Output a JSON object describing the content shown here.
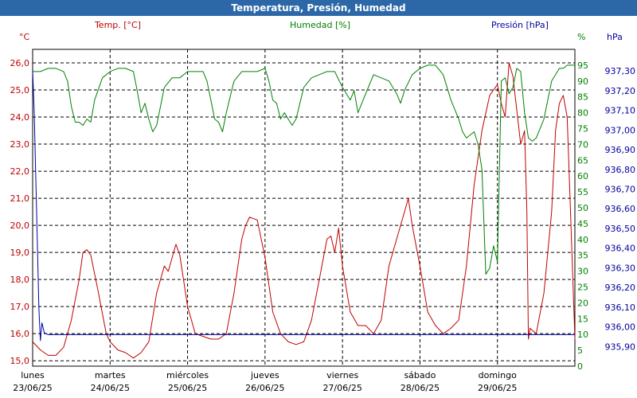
{
  "window": {
    "title": "Temperatura, Presión, Humedad"
  },
  "colors": {
    "temp": "#c00000",
    "hum": "#008000",
    "pres": "#0000a0",
    "header_bg": "#2c68a8",
    "grid": "#000000"
  },
  "chart_data": {
    "type": "line",
    "x_ticks": [
      {
        "day": "lunes",
        "date": "23/06/25"
      },
      {
        "day": "martes",
        "date": "24/06/25"
      },
      {
        "day": "miércoles",
        "date": "25/06/25"
      },
      {
        "day": "jueves",
        "date": "26/06/25"
      },
      {
        "day": "viernes",
        "date": "27/06/25"
      },
      {
        "day": "sábado",
        "date": "28/06/25"
      },
      {
        "day": "domingo",
        "date": "29/06/25"
      }
    ],
    "x_range_days": [
      0,
      7.0
    ],
    "axes": {
      "temp": {
        "label": "Temp. [°C]",
        "unit": "°C",
        "ylim": [
          14.8,
          26.5
        ],
        "ticks": [
          "15,0",
          "16,0",
          "17,0",
          "18,0",
          "19,0",
          "20,0",
          "21,0",
          "22,0",
          "23,0",
          "24,0",
          "25,0",
          "26,0"
        ]
      },
      "hum": {
        "label": "Humedad [%]",
        "unit": "%",
        "ylim": [
          0,
          100
        ],
        "ticks": [
          "0",
          "5",
          "10",
          "15",
          "20",
          "25",
          "30",
          "35",
          "40",
          "45",
          "50",
          "55",
          "60",
          "65",
          "70",
          "75",
          "80",
          "85",
          "90",
          "95"
        ]
      },
      "pres": {
        "label": "Presión [hPa]",
        "unit": "hPa",
        "ylim": [
          935.8,
          937.41
        ],
        "ticks": [
          "935,90",
          "936,00",
          "936,10",
          "936,20",
          "936,30",
          "936,40",
          "936,50",
          "936,60",
          "936,70",
          "936,80",
          "936,90",
          "937,00",
          "937,10",
          "937,20",
          "937,30"
        ]
      }
    },
    "grid": true,
    "series": [
      {
        "name": "Temp. [°C]",
        "axis": "temp",
        "points": [
          [
            0.0,
            15.7
          ],
          [
            0.1,
            15.4
          ],
          [
            0.2,
            15.2
          ],
          [
            0.3,
            15.2
          ],
          [
            0.4,
            15.5
          ],
          [
            0.5,
            16.5
          ],
          [
            0.6,
            18.0
          ],
          [
            0.65,
            19.0
          ],
          [
            0.7,
            19.1
          ],
          [
            0.75,
            18.9
          ],
          [
            0.85,
            17.5
          ],
          [
            0.95,
            16.0
          ],
          [
            1.0,
            15.7
          ],
          [
            1.1,
            15.4
          ],
          [
            1.2,
            15.3
          ],
          [
            1.3,
            15.1
          ],
          [
            1.4,
            15.3
          ],
          [
            1.5,
            15.7
          ],
          [
            1.6,
            17.5
          ],
          [
            1.7,
            18.5
          ],
          [
            1.75,
            18.3
          ],
          [
            1.8,
            18.8
          ],
          [
            1.85,
            19.3
          ],
          [
            1.9,
            18.9
          ],
          [
            2.0,
            17.0
          ],
          [
            2.1,
            16.0
          ],
          [
            2.2,
            15.9
          ],
          [
            2.3,
            15.8
          ],
          [
            2.4,
            15.8
          ],
          [
            2.5,
            16.0
          ],
          [
            2.6,
            17.5
          ],
          [
            2.7,
            19.5
          ],
          [
            2.75,
            20.0
          ],
          [
            2.8,
            20.3
          ],
          [
            2.9,
            20.2
          ],
          [
            3.0,
            18.8
          ],
          [
            3.1,
            16.8
          ],
          [
            3.2,
            16.0
          ],
          [
            3.3,
            15.7
          ],
          [
            3.4,
            15.6
          ],
          [
            3.5,
            15.7
          ],
          [
            3.6,
            16.5
          ],
          [
            3.7,
            18.0
          ],
          [
            3.8,
            19.5
          ],
          [
            3.85,
            19.6
          ],
          [
            3.9,
            19.0
          ],
          [
            3.95,
            19.9
          ],
          [
            4.0,
            18.5
          ],
          [
            4.1,
            16.8
          ],
          [
            4.2,
            16.3
          ],
          [
            4.3,
            16.3
          ],
          [
            4.4,
            16.0
          ],
          [
            4.5,
            16.5
          ],
          [
            4.6,
            18.5
          ],
          [
            4.7,
            19.5
          ],
          [
            4.8,
            20.5
          ],
          [
            4.85,
            21.0
          ],
          [
            4.9,
            20.0
          ],
          [
            5.0,
            18.5
          ],
          [
            5.1,
            16.8
          ],
          [
            5.2,
            16.3
          ],
          [
            5.3,
            16.0
          ],
          [
            5.4,
            16.2
          ],
          [
            5.5,
            16.5
          ],
          [
            5.6,
            18.5
          ],
          [
            5.7,
            21.5
          ],
          [
            5.8,
            23.5
          ],
          [
            5.9,
            24.8
          ],
          [
            6.0,
            25.2
          ],
          [
            6.05,
            24.5
          ],
          [
            6.1,
            24.0
          ],
          [
            6.15,
            26.0
          ],
          [
            6.2,
            25.5
          ],
          [
            6.3,
            23.0
          ],
          [
            6.35,
            23.5
          ],
          [
            6.38,
            20.5
          ],
          [
            6.4,
            15.8
          ],
          [
            6.42,
            16.2
          ],
          [
            6.5,
            16.0
          ],
          [
            6.6,
            17.5
          ],
          [
            6.7,
            20.5
          ],
          [
            6.75,
            23.5
          ],
          [
            6.8,
            24.5
          ],
          [
            6.85,
            24.8
          ],
          [
            6.9,
            24.0
          ],
          [
            6.95,
            20.0
          ],
          [
            7.0,
            15.8
          ]
        ]
      },
      {
        "name": "Humedad [%]",
        "axis": "hum",
        "points": [
          [
            0.0,
            93
          ],
          [
            0.1,
            93
          ],
          [
            0.2,
            94
          ],
          [
            0.3,
            94
          ],
          [
            0.4,
            93
          ],
          [
            0.45,
            90
          ],
          [
            0.5,
            82
          ],
          [
            0.55,
            77
          ],
          [
            0.6,
            77
          ],
          [
            0.65,
            76
          ],
          [
            0.7,
            78
          ],
          [
            0.75,
            77
          ],
          [
            0.8,
            84
          ],
          [
            0.9,
            91
          ],
          [
            1.0,
            93
          ],
          [
            1.1,
            94
          ],
          [
            1.2,
            94
          ],
          [
            1.3,
            93
          ],
          [
            1.35,
            87
          ],
          [
            1.4,
            80
          ],
          [
            1.45,
            83
          ],
          [
            1.5,
            78
          ],
          [
            1.55,
            74
          ],
          [
            1.6,
            76
          ],
          [
            1.7,
            88
          ],
          [
            1.8,
            91
          ],
          [
            1.9,
            91
          ],
          [
            2.0,
            93
          ],
          [
            2.1,
            93
          ],
          [
            2.2,
            93
          ],
          [
            2.25,
            90
          ],
          [
            2.3,
            84
          ],
          [
            2.35,
            78
          ],
          [
            2.4,
            77
          ],
          [
            2.45,
            74
          ],
          [
            2.5,
            80
          ],
          [
            2.6,
            90
          ],
          [
            2.7,
            93
          ],
          [
            2.8,
            93
          ],
          [
            2.9,
            93
          ],
          [
            3.0,
            94
          ],
          [
            3.05,
            90
          ],
          [
            3.1,
            84
          ],
          [
            3.15,
            83
          ],
          [
            3.2,
            78
          ],
          [
            3.25,
            80
          ],
          [
            3.3,
            78
          ],
          [
            3.35,
            76
          ],
          [
            3.4,
            78
          ],
          [
            3.5,
            88
          ],
          [
            3.6,
            91
          ],
          [
            3.7,
            92
          ],
          [
            3.8,
            93
          ],
          [
            3.9,
            93
          ],
          [
            4.0,
            88
          ],
          [
            4.1,
            84
          ],
          [
            4.15,
            87
          ],
          [
            4.2,
            80
          ],
          [
            4.3,
            86
          ],
          [
            4.4,
            92
          ],
          [
            4.5,
            91
          ],
          [
            4.6,
            90
          ],
          [
            4.7,
            86
          ],
          [
            4.75,
            83
          ],
          [
            4.8,
            87
          ],
          [
            4.9,
            92
          ],
          [
            5.0,
            94
          ],
          [
            5.1,
            95
          ],
          [
            5.2,
            95
          ],
          [
            5.3,
            92
          ],
          [
            5.4,
            84
          ],
          [
            5.5,
            78
          ],
          [
            5.55,
            74
          ],
          [
            5.6,
            72
          ],
          [
            5.7,
            74
          ],
          [
            5.75,
            70
          ],
          [
            5.8,
            62
          ],
          [
            5.85,
            29
          ],
          [
            5.9,
            31
          ],
          [
            5.95,
            38
          ],
          [
            6.0,
            33
          ],
          [
            6.05,
            90
          ],
          [
            6.1,
            91
          ],
          [
            6.15,
            86
          ],
          [
            6.2,
            88
          ],
          [
            6.25,
            94
          ],
          [
            6.3,
            93
          ],
          [
            6.35,
            80
          ],
          [
            6.4,
            72
          ],
          [
            6.45,
            71
          ],
          [
            6.5,
            72
          ],
          [
            6.6,
            78
          ],
          [
            6.7,
            90
          ],
          [
            6.8,
            94
          ],
          [
            6.85,
            94
          ],
          [
            6.9,
            95
          ],
          [
            7.0,
            95
          ]
        ]
      },
      {
        "name": "Presión [hPa]",
        "axis": "pres",
        "points": [
          [
            0.0,
            937.3
          ],
          [
            0.02,
            937.1
          ],
          [
            0.05,
            936.6
          ],
          [
            0.08,
            936.1
          ],
          [
            0.1,
            935.93
          ],
          [
            0.12,
            936.02
          ],
          [
            0.15,
            935.97
          ],
          [
            0.2,
            935.96
          ],
          [
            0.3,
            935.96
          ],
          [
            1.0,
            935.96
          ],
          [
            2.0,
            935.96
          ],
          [
            3.0,
            935.96
          ],
          [
            4.0,
            935.96
          ],
          [
            5.0,
            935.96
          ],
          [
            6.0,
            935.96
          ],
          [
            7.0,
            935.96
          ]
        ]
      }
    ]
  }
}
